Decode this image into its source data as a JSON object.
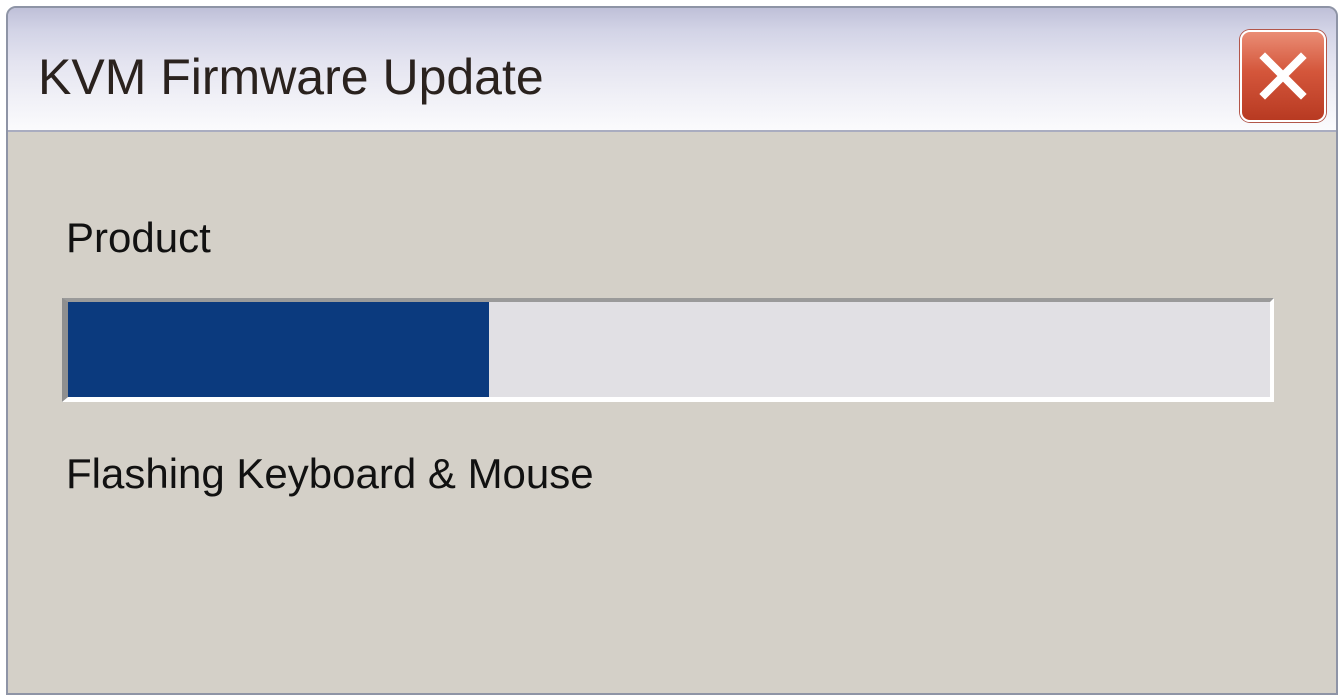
{
  "window": {
    "title": "KVM Firmware Update"
  },
  "product": {
    "label": "Product"
  },
  "progress": {
    "fraction": 0.35,
    "fill_color": "#0b3a7e"
  },
  "status": {
    "text": "Flashing Keyboard & Mouse"
  },
  "icons": {
    "close": "close-icon"
  },
  "colors": {
    "dialog_background": "#d4d0c8",
    "close_button": "#d4563b"
  }
}
